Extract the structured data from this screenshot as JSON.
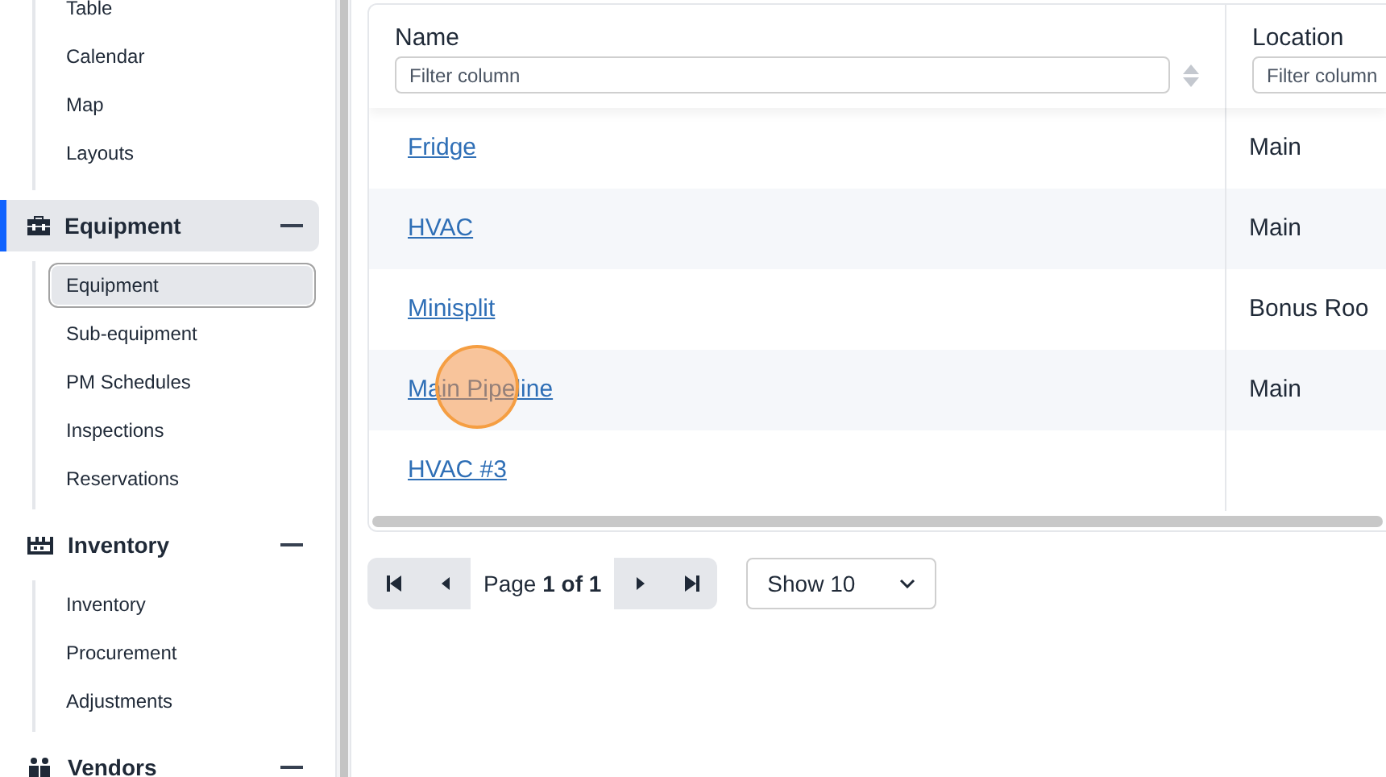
{
  "sidebar": {
    "leading_items": [
      {
        "label": "Table",
        "selected": false
      },
      {
        "label": "Calendar",
        "selected": false
      },
      {
        "label": "Map",
        "selected": false
      },
      {
        "label": "Layouts",
        "selected": false
      }
    ],
    "sections": [
      {
        "kind": "equipment",
        "label": "Equipment",
        "selected": true,
        "expanded": true,
        "items": [
          {
            "label": "Equipment",
            "selected": true
          },
          {
            "label": "Sub-equipment",
            "selected": false
          },
          {
            "label": "PM Schedules",
            "selected": false
          },
          {
            "label": "Inspections",
            "selected": false
          },
          {
            "label": "Reservations",
            "selected": false
          }
        ]
      },
      {
        "kind": "inventory",
        "label": "Inventory",
        "selected": false,
        "expanded": true,
        "items": [
          {
            "label": "Inventory",
            "selected": false
          },
          {
            "label": "Procurement",
            "selected": false
          },
          {
            "label": "Adjustments",
            "selected": false
          }
        ]
      },
      {
        "kind": "vendors",
        "label": "Vendors",
        "selected": false,
        "expanded": true
      }
    ]
  },
  "table": {
    "columns": [
      {
        "title": "Name",
        "filter_placeholder": "Filter column"
      },
      {
        "title": "Location",
        "filter_placeholder": "Filter column"
      }
    ],
    "rows": [
      {
        "name": "Fridge",
        "location": "Main"
      },
      {
        "name": "HVAC",
        "location": "Main"
      },
      {
        "name": "Minisplit",
        "location": "Bonus Roo"
      },
      {
        "name": "Main Pipeline",
        "location": "Main"
      },
      {
        "name": "HVAC #3"
      }
    ]
  },
  "pagination": {
    "page_label": "Page **1 of 1**",
    "page_size": "Show 10"
  }
}
